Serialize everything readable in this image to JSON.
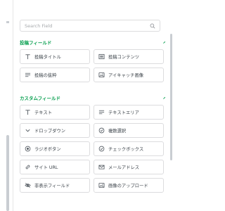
{
  "search": {
    "placeholder": "Search Field"
  },
  "sections": [
    {
      "title": "投稿フィールド",
      "items": [
        {
          "label": "投稿タイトル",
          "icon": "title-text-icon"
        },
        {
          "label": "投稿コンテンツ",
          "icon": "content-icon"
        },
        {
          "label": "投稿の抜粋",
          "icon": "excerpt-icon"
        },
        {
          "label": "アイキャッチ画像",
          "icon": "image-icon"
        }
      ]
    },
    {
      "title": "カスタムフィールド",
      "items": [
        {
          "label": "テキスト",
          "icon": "text-icon"
        },
        {
          "label": "テキストエリア",
          "icon": "textarea-icon"
        },
        {
          "label": "ドロップダウン",
          "icon": "chevron-down-icon"
        },
        {
          "label": "複数選択",
          "icon": "check-circle-icon"
        },
        {
          "label": "ラジオボタン",
          "icon": "radio-icon"
        },
        {
          "label": "チェックボックス",
          "icon": "check-circle-icon"
        },
        {
          "label": "サイト URL",
          "icon": "link-icon"
        },
        {
          "label": "メールアドレス",
          "icon": "envelope-icon"
        },
        {
          "label": "非表示フィールド",
          "icon": "eye-slash-icon"
        },
        {
          "label": "画像のアップロード",
          "icon": "image-icon"
        }
      ]
    }
  ],
  "colors": {
    "accent": "#0aa051",
    "border": "#dcdcde",
    "text": "#3c434a"
  }
}
